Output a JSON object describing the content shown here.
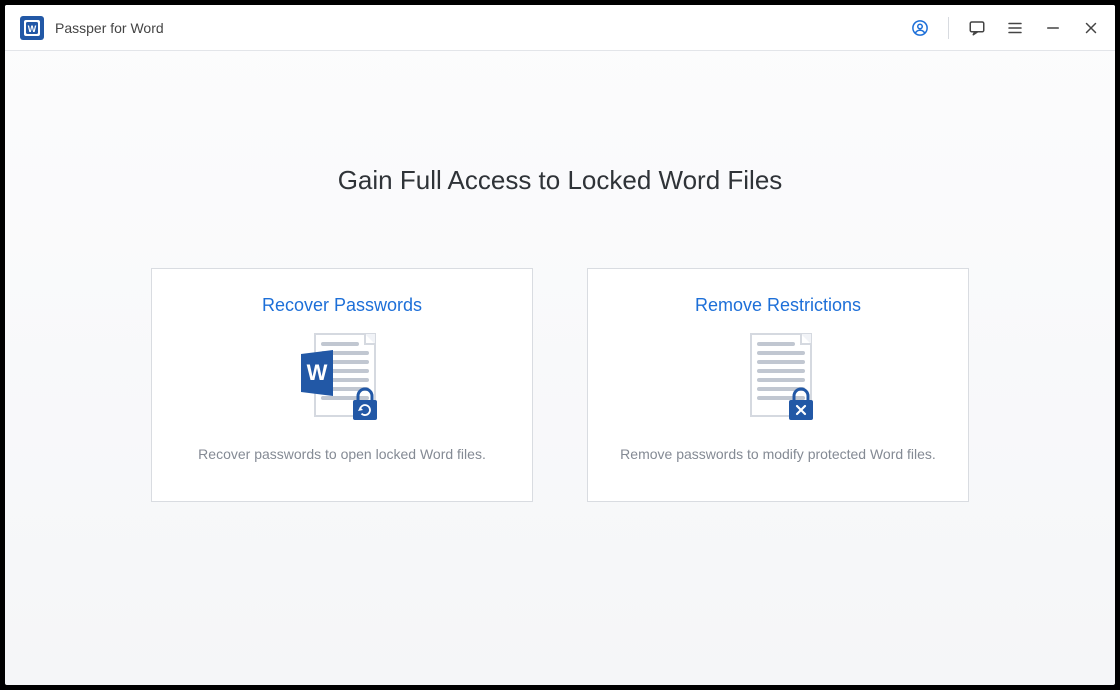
{
  "app": {
    "title": "Passper for Word"
  },
  "colors": {
    "accent": "#1d6fd8",
    "accent2": "#2258a6"
  },
  "main": {
    "title": "Gain Full Access to Locked Word Files"
  },
  "cards": {
    "recover": {
      "title": "Recover Passwords",
      "desc": "Recover passwords to open locked Word files."
    },
    "remove": {
      "title": "Remove Restrictions",
      "desc": "Remove passwords to modify protected Word files."
    }
  }
}
